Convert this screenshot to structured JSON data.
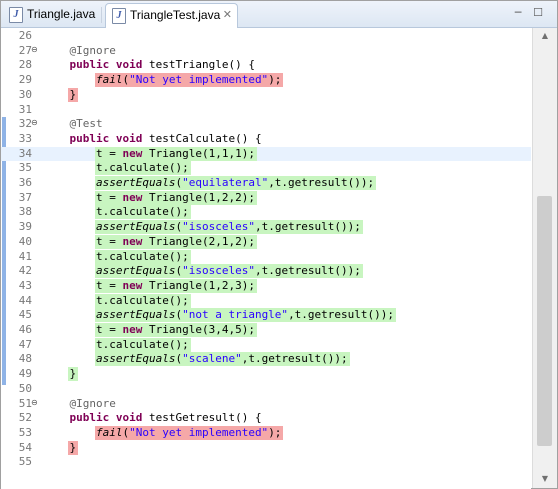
{
  "tabs": [
    {
      "label": "Triangle.java",
      "active": false
    },
    {
      "label": "TriangleTest.java",
      "active": true,
      "close": "✕"
    }
  ],
  "window_controls": {
    "minimize": "─",
    "maximize": "☐"
  },
  "scrollbar": {
    "up": "▲",
    "down": "▼"
  },
  "colors": {
    "covered": "#c8f5c0",
    "not_covered": "#f5a8a8",
    "keyword": "#7f0055",
    "string": "#2a00ff",
    "annotation": "#646464"
  },
  "editor": {
    "current_line": 34,
    "lines": [
      {
        "n": "26",
        "tokens": []
      },
      {
        "n": "27",
        "fold": "⊖",
        "tokens": [
          [
            "ann",
            "    @Ignore"
          ]
        ]
      },
      {
        "n": "28",
        "tokens": [
          [
            "",
            "    "
          ],
          [
            "kw",
            "public void"
          ],
          [
            "",
            " testTriangle() {"
          ]
        ]
      },
      {
        "n": "29",
        "hl": "red",
        "tokens": [
          [
            "",
            "        "
          ],
          [
            "it",
            "fail"
          ],
          [
            "",
            "("
          ],
          [
            "str",
            "\"Not yet implemented\""
          ],
          [
            "",
            ");"
          ]
        ]
      },
      {
        "n": "30",
        "hl": "red",
        "tokens": [
          [
            "",
            "    }"
          ]
        ]
      },
      {
        "n": "31",
        "tokens": []
      },
      {
        "n": "32",
        "fold": "⊖",
        "tokens": [
          [
            "ann",
            "    @Test"
          ]
        ]
      },
      {
        "n": "33",
        "tokens": [
          [
            "",
            "    "
          ],
          [
            "kw",
            "public void"
          ],
          [
            "",
            " testCalculate() {"
          ]
        ]
      },
      {
        "n": "34",
        "hl": "green",
        "tokens": [
          [
            "",
            "        t = "
          ],
          [
            "kw",
            "new"
          ],
          [
            "",
            " Triangle(1,1,1);"
          ]
        ]
      },
      {
        "n": "35",
        "hl": "green",
        "tokens": [
          [
            "",
            "        t.calculate();"
          ]
        ]
      },
      {
        "n": "36",
        "hl": "green",
        "tokens": [
          [
            "",
            "        "
          ],
          [
            "it",
            "assertEquals"
          ],
          [
            "",
            "("
          ],
          [
            "str",
            "\"equilateral\""
          ],
          [
            "",
            ",t.getresult());"
          ]
        ]
      },
      {
        "n": "37",
        "hl": "green",
        "tokens": [
          [
            "",
            "        t = "
          ],
          [
            "kw",
            "new"
          ],
          [
            "",
            " Triangle(1,2,2);"
          ]
        ]
      },
      {
        "n": "38",
        "hl": "green",
        "tokens": [
          [
            "",
            "        t.calculate();"
          ]
        ]
      },
      {
        "n": "39",
        "hl": "green",
        "tokens": [
          [
            "",
            "        "
          ],
          [
            "it",
            "assertEquals"
          ],
          [
            "",
            "("
          ],
          [
            "str",
            "\"isosceles\""
          ],
          [
            "",
            ",t.getresult());"
          ]
        ]
      },
      {
        "n": "40",
        "hl": "green",
        "tokens": [
          [
            "",
            "        t = "
          ],
          [
            "kw",
            "new"
          ],
          [
            "",
            " Triangle(2,1,2);"
          ]
        ]
      },
      {
        "n": "41",
        "hl": "green",
        "tokens": [
          [
            "",
            "        t.calculate();"
          ]
        ]
      },
      {
        "n": "42",
        "hl": "green",
        "tokens": [
          [
            "",
            "        "
          ],
          [
            "it",
            "assertEquals"
          ],
          [
            "",
            "("
          ],
          [
            "str",
            "\"isosceles\""
          ],
          [
            "",
            ",t.getresult());"
          ]
        ]
      },
      {
        "n": "43",
        "hl": "green",
        "tokens": [
          [
            "",
            "        t = "
          ],
          [
            "kw",
            "new"
          ],
          [
            "",
            " Triangle(1,2,3);"
          ]
        ]
      },
      {
        "n": "44",
        "hl": "green",
        "tokens": [
          [
            "",
            "        t.calculate();"
          ]
        ]
      },
      {
        "n": "45",
        "hl": "green",
        "tokens": [
          [
            "",
            "        "
          ],
          [
            "it",
            "assertEquals"
          ],
          [
            "",
            "("
          ],
          [
            "str",
            "\"not a triangle\""
          ],
          [
            "",
            ",t.getresult());"
          ]
        ]
      },
      {
        "n": "46",
        "hl": "green",
        "tokens": [
          [
            "",
            "        t = "
          ],
          [
            "kw",
            "new"
          ],
          [
            "",
            " Triangle(3,4,5);"
          ]
        ]
      },
      {
        "n": "47",
        "hl": "green",
        "tokens": [
          [
            "",
            "        t.calculate();"
          ]
        ]
      },
      {
        "n": "48",
        "hl": "green",
        "tokens": [
          [
            "",
            "        "
          ],
          [
            "it",
            "assertEquals"
          ],
          [
            "",
            "("
          ],
          [
            "str",
            "\"scalene\""
          ],
          [
            "",
            ",t.getresult());"
          ]
        ]
      },
      {
        "n": "49",
        "hl": "green",
        "tokens": [
          [
            "",
            "    }"
          ]
        ]
      },
      {
        "n": "50",
        "tokens": []
      },
      {
        "n": "51",
        "fold": "⊖",
        "tokens": [
          [
            "ann",
            "    @Ignore"
          ]
        ]
      },
      {
        "n": "52",
        "tokens": [
          [
            "",
            "    "
          ],
          [
            "kw",
            "public void"
          ],
          [
            "",
            " testGetresult() {"
          ]
        ]
      },
      {
        "n": "53",
        "hl": "red",
        "tokens": [
          [
            "",
            "        "
          ],
          [
            "it",
            "fail"
          ],
          [
            "",
            "("
          ],
          [
            "str",
            "\"Not yet implemented\""
          ],
          [
            "",
            ");"
          ]
        ]
      },
      {
        "n": "54",
        "hl": "red",
        "tokens": [
          [
            "",
            "    }"
          ]
        ]
      },
      {
        "n": "55",
        "tokens": []
      }
    ]
  }
}
